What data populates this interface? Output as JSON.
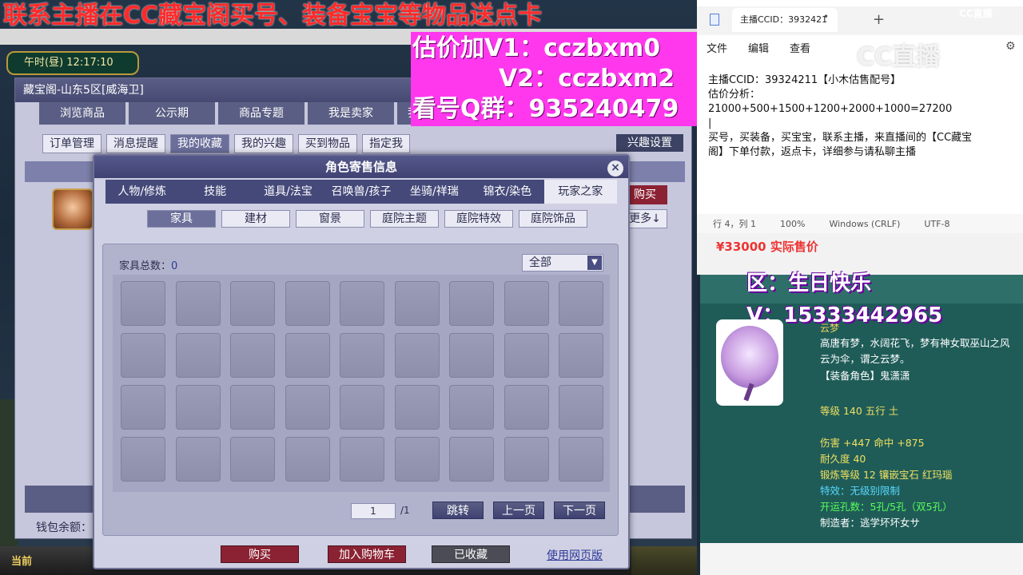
{
  "overlay": {
    "line1": "联系主播在CC藏宝阁买号、装备宝宝等物品送点卡",
    "line2": "估价加V1：cczbxm0",
    "line3": "V2：cczbxm2",
    "line4": "看号Q群：935240479"
  },
  "game": {
    "clock": "午时(昼)  12:17:10",
    "bottom_label": "当前"
  },
  "cbg": {
    "title": "藏宝阁-山东5区[威海卫]",
    "tabs": [
      "浏览商品",
      "公示期",
      "商品专题",
      "我是卖家",
      "我"
    ],
    "subtabs": [
      "订单管理",
      "消息提醒",
      "我的收藏",
      "我的兴趣",
      "买到物品",
      "指定我"
    ],
    "active_subtab": "我的收藏",
    "interest_button": "兴趣设置",
    "buy_button": "购买",
    "more_button": "更多↓",
    "wallet_label": "钱包余额："
  },
  "dialog": {
    "title": "角色寄售信息",
    "close": "×",
    "tabs": [
      "人物/修炼",
      "技能",
      "道具/法宝",
      "召唤兽/孩子",
      "坐骑/祥瑞",
      "锦衣/染色",
      "玩家之家"
    ],
    "active_tab": "玩家之家",
    "subtabs": [
      "家具",
      "建材",
      "窗景",
      "庭院主题",
      "庭院特效",
      "庭院饰品"
    ],
    "active_subtab": "家具",
    "furniture_count_label": "家具总数：",
    "furniture_count": "0",
    "filter_value": "全部",
    "page_current": "1",
    "page_total": "/1",
    "jump_button": "跳转",
    "prev_button": "上一页",
    "next_button": "下一页",
    "buy_button": "购买",
    "cart_button": "加入购物车",
    "favorited_button": "已收藏",
    "web_link": "使用网页版"
  },
  "notepad": {
    "tab_title": "主播CCID：3932421",
    "menu": [
      "文件",
      "编辑",
      "查看"
    ],
    "body_lines": [
      "主播CCID：39324211【小木估售配号】",
      "估价分析：",
      "21000+500+1500+1200+2000+1000=27200",
      "|",
      "买号，买装备，买宝宝，联系主播，来直播间的【CC藏宝",
      "阁】下单付款，返点卡，详细参与请私聊主播"
    ],
    "status": [
      "行 4，列 1",
      "100%",
      "Windows (CRLF)",
      "UTF-8"
    ]
  },
  "cc_logo": "CC直播",
  "cc_watermark": "CC直播",
  "shop": {
    "price": "¥33000 实际售价"
  },
  "item": {
    "zone": "区：生日快乐",
    "contact": "V：15333442965",
    "name": "云梦",
    "desc": "高唐有梦，水阔花飞，梦有神女取巫山之风云为伞，谓之云梦。",
    "role": "【装备角色】鬼潇潇",
    "level": "等级 140  五行 土",
    "attack": "伤害 +447  命中 +875",
    "durability": "耐久度 40",
    "forge": "锻炼等级 12  镶嵌宝石 红玛瑙",
    "special": "特效：无级别限制",
    "slots": "开运孔数：5孔/5孔（双5孔）",
    "maker": "制造者：逃学坏坏女サ"
  }
}
